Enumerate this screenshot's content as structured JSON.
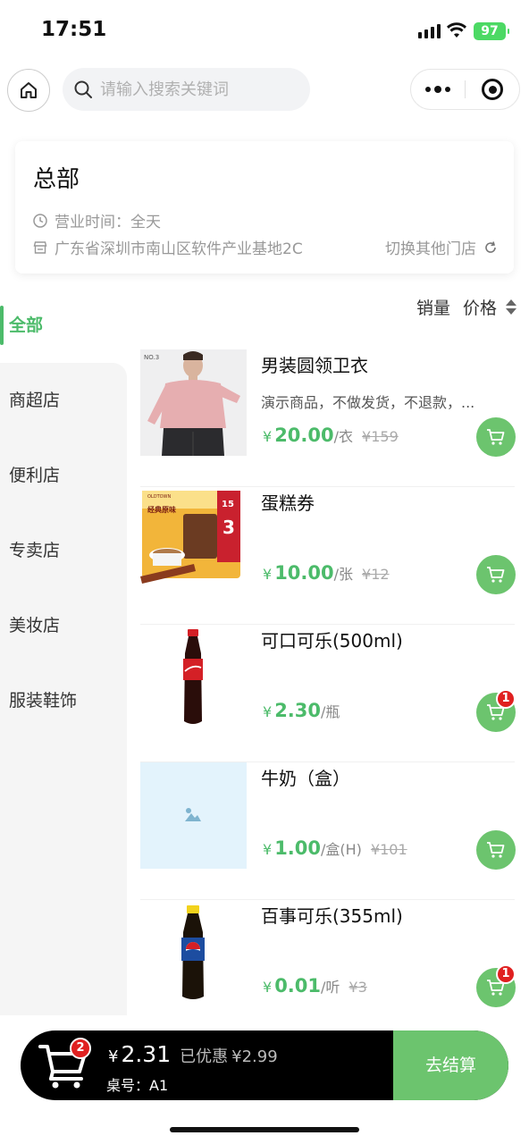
{
  "status_bar": {
    "time": "17:51",
    "battery": "97"
  },
  "search": {
    "placeholder": "请输入搜索关键词"
  },
  "store": {
    "name": "总部",
    "hours": "营业时间：全天",
    "address": "广东省深圳市南山区软件产业基地2C",
    "switch_label": "切换其他门店"
  },
  "sort": {
    "sales_label": "销量",
    "price_label": "价格"
  },
  "categories": [
    "全部",
    "商超店",
    "便利店",
    "专卖店",
    "美妆店",
    "服装鞋饰"
  ],
  "products": [
    {
      "name": "男装圆领卫衣",
      "desc": "演示商品，不做发货，不退款，...",
      "yen": "¥",
      "price": "20.00",
      "unit": "/衣",
      "original": "¥159",
      "cart_count": ""
    },
    {
      "name": "蛋糕券",
      "desc": "",
      "yen": "¥",
      "price": "10.00",
      "unit": "/张",
      "original": "¥12",
      "cart_count": ""
    },
    {
      "name": "可口可乐(500ml)",
      "desc": "",
      "yen": "¥",
      "price": "2.30",
      "unit": "/瓶",
      "original": "",
      "cart_count": "1"
    },
    {
      "name": "牛奶（盒）",
      "desc": "",
      "yen": "¥",
      "price": "1.00",
      "unit": "/盒(H)",
      "original": "¥101",
      "cart_count": ""
    },
    {
      "name": "百事可乐(355ml)",
      "desc": "",
      "yen": "¥",
      "price": "0.01",
      "unit": "/听",
      "original": "¥3",
      "cart_count": "1"
    }
  ],
  "product_images": {
    "coffee_text_1": "经典原味",
    "coffee_text_2": "3",
    "coffee_text_3": "15",
    "coffee_brand": "OLDTOWN"
  },
  "bottom_bar": {
    "cart_count": "2",
    "yen": "¥",
    "total": "2.31",
    "discount_label": "已优惠",
    "discount": "¥2.99",
    "table": "桌号：A1",
    "checkout_label": "去结算"
  },
  "colors": {
    "accent": "#4cbb6a",
    "button_green": "#6cc46e",
    "badge_red": "#e02020"
  }
}
